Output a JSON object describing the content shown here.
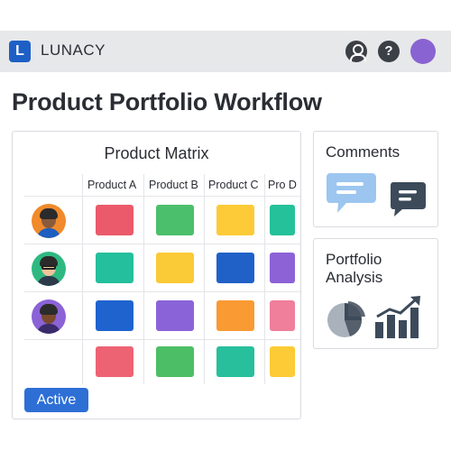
{
  "app": {
    "name": "LUNACY",
    "logo_letter": "L"
  },
  "topbar": {
    "icons": [
      "user-icon",
      "help-icon",
      "avatar"
    ],
    "help_glyph": "?"
  },
  "page": {
    "title": "Product Portfolio Workflow"
  },
  "matrix": {
    "title": "Product Matrix",
    "columns": [
      "Product A",
      "Product B",
      "Product C",
      "Pro D"
    ],
    "rows": [
      {
        "avatar": "avatar-person-orange",
        "cells": [
          "#ea5a6a",
          "#4bbf6b",
          "#fccb37",
          "#25c19a"
        ]
      },
      {
        "avatar": "avatar-person-green-glasses",
        "cells": [
          "#24bf9c",
          "#fbca37",
          "#2061c7",
          "#8c62d6"
        ]
      },
      {
        "avatar": "avatar-person-purple",
        "cells": [
          "#1f63cf",
          "#8b63d8",
          "#f99a33",
          "#ef7f9a"
        ]
      },
      {
        "avatar": "",
        "cells": [
          "#ee6373",
          "#4cbe66",
          "#27bf9c",
          "#fccb36"
        ]
      }
    ],
    "status_badge": "Active"
  },
  "comments": {
    "title": "Comments",
    "icons": [
      "chat-bubble-blue-icon",
      "chat-bubble-dark-icon"
    ]
  },
  "analysis": {
    "title_line1": "Portfolio",
    "title_line2": "Analysis",
    "icons": [
      "pie-chart-icon",
      "bar-growth-icon"
    ]
  },
  "colors": {
    "accent": "#2e6fd6",
    "logo": "#1e5fc6",
    "dark_icon": "#3b3f46",
    "avatar": "#8a63d2"
  }
}
